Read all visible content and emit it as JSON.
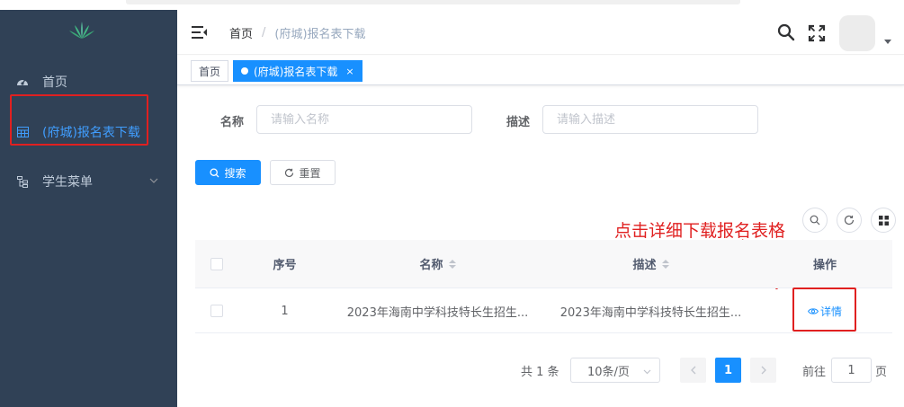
{
  "sidebar": {
    "items": [
      {
        "label": "首页",
        "icon": "dashboard-icon"
      },
      {
        "label": "(府城)报名表下载",
        "icon": "table-icon",
        "active": true
      },
      {
        "label": "学生菜单",
        "icon": "tree-icon",
        "expandable": true
      }
    ]
  },
  "header": {
    "breadcrumb_home": "首页",
    "breadcrumb_sep": "/",
    "breadcrumb_current": "(府城)报名表下载"
  },
  "tags": {
    "home": "首页",
    "current": "(府城)报名表下载",
    "close": "×"
  },
  "form": {
    "name_label": "名称",
    "name_placeholder": "请输入名称",
    "desc_label": "描述",
    "desc_placeholder": "请输入描述",
    "search_button": "搜索",
    "reset_button": "重置"
  },
  "annotation": {
    "text": "点击详细下载报名表格",
    "color": "#e02020"
  },
  "table": {
    "headers": {
      "index": "序号",
      "name": "名称",
      "desc": "描述",
      "action": "操作"
    },
    "rows": [
      {
        "index": "1",
        "name": "2023年海南中学科技特长生招生...",
        "desc": "2023年海南中学科技特长生招生...",
        "action": "详情"
      }
    ]
  },
  "pagination": {
    "total": "共 1 条",
    "page_size": "10条/页",
    "current_page": "1",
    "goto_label": "前往",
    "goto_value": "1",
    "page_suffix": "页"
  },
  "colors": {
    "sidebar_bg": "#304156",
    "primary": "#1890ff",
    "annotation_red": "#e02020"
  }
}
